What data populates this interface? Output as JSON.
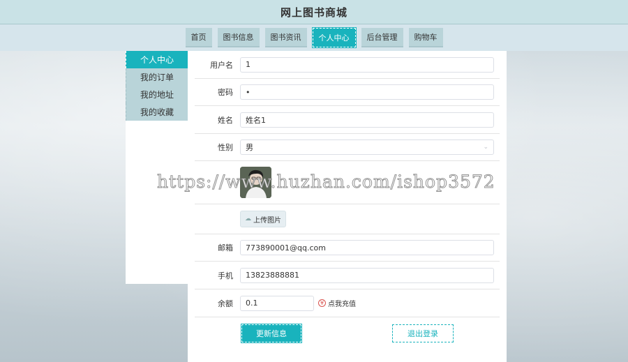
{
  "site": {
    "title": "网上图书商城"
  },
  "nav": {
    "items": [
      {
        "label": "首页"
      },
      {
        "label": "图书信息"
      },
      {
        "label": "图书资讯"
      },
      {
        "label": "个人中心"
      },
      {
        "label": "后台管理"
      },
      {
        "label": "购物车"
      }
    ],
    "active": "个人中心"
  },
  "sidebar": {
    "items": [
      {
        "label": "个人中心"
      },
      {
        "label": "我的订单"
      },
      {
        "label": "我的地址"
      },
      {
        "label": "我的收藏"
      }
    ],
    "active": "个人中心"
  },
  "form": {
    "username": {
      "label": "用户名",
      "value": "1"
    },
    "password": {
      "label": "密码",
      "value": "•"
    },
    "name": {
      "label": "姓名",
      "value": "姓名1"
    },
    "gender": {
      "label": "性别",
      "value": "男"
    },
    "upload_label": "上传图片",
    "email": {
      "label": "邮箱",
      "value": "773890001@qq.com"
    },
    "phone": {
      "label": "手机",
      "value": "13823888881"
    },
    "balance": {
      "label": "余额",
      "value": "0.1"
    },
    "recharge_label": "点我充值",
    "update_label": "更新信息",
    "logout_label": "退出登录"
  },
  "icons": {
    "recharge": "yen-icon",
    "select": "chevron-down-icon",
    "upload": "upload-icon"
  },
  "colors": {
    "accent": "#19b3bd",
    "nav_bg": "#b9d4d9",
    "header_bg": "#c9e2e6"
  },
  "watermark": "https://www.huzhan.com/ishop3572"
}
